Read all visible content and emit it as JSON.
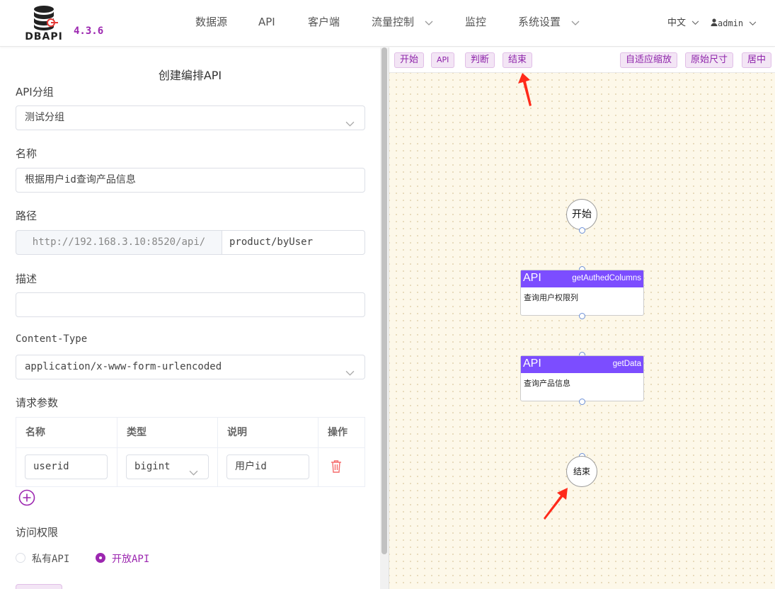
{
  "header": {
    "logo_text": "DBAPI",
    "version": "4.3.6",
    "nav": [
      {
        "label": "数据源"
      },
      {
        "label": "API"
      },
      {
        "label": "客户端"
      },
      {
        "label": "流量控制"
      },
      {
        "label": "监控"
      },
      {
        "label": "系统设置"
      }
    ],
    "language": "中文",
    "user": "admin"
  },
  "form": {
    "title": "创建编排API",
    "group_label": "API分组",
    "group_value": "测试分组",
    "name_label": "名称",
    "name_value": "根据用户id查询产品信息",
    "path_label": "路径",
    "path_prefix": "http://192.168.3.10:8520/api/",
    "path_value": "product/byUser",
    "desc_label": "描述",
    "desc_value": "",
    "content_type_label": "Content-Type",
    "content_type_value": "application/x-www-form-urlencoded",
    "params_label": "请求参数",
    "params_columns": [
      "名称",
      "类型",
      "说明",
      "操作"
    ],
    "params_rows": [
      {
        "name": "userid",
        "type": "bigint",
        "desc": "用户id"
      }
    ],
    "access_label": "访问权限",
    "access_options": [
      "私有API",
      "开放API"
    ],
    "access_selected": "开放API"
  },
  "toolbar": {
    "left_buttons": [
      "开始",
      "API",
      "判断",
      "结束"
    ],
    "right_buttons": [
      "自适应缩放",
      "原始尺寸",
      "居中"
    ]
  },
  "canvas": {
    "start_node": "开始",
    "end_node": "结束",
    "api_nodes": [
      {
        "tag": "API",
        "name": "getAuthedColumns",
        "desc": "查询用户权限列"
      },
      {
        "tag": "API",
        "name": "getData",
        "desc": "查询产品信息"
      }
    ]
  },
  "colors": {
    "accent": "#9c27b0",
    "api_header": "#7c4dff",
    "canvas_bg": "#fdf8e9",
    "arrow": "#ff2a1a"
  }
}
